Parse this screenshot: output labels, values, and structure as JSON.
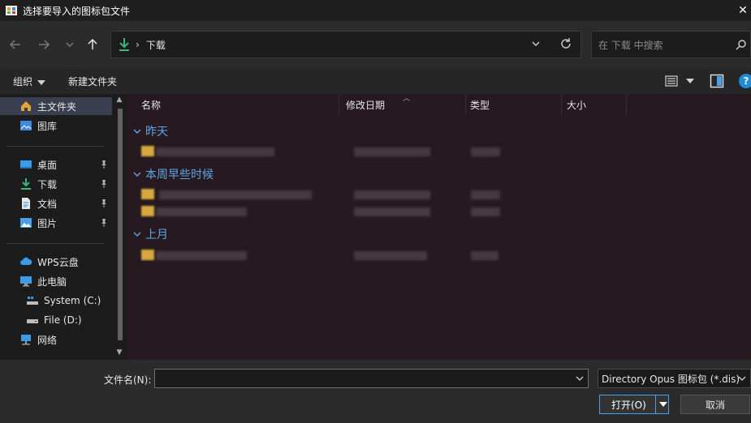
{
  "window": {
    "title": "选择要导入的图标包文件"
  },
  "nav": {
    "address_crumb": "下载",
    "search_placeholder": "在 下载 中搜索"
  },
  "toolbar": {
    "organize_label": "组织",
    "new_folder_label": "新建文件夹"
  },
  "sidebar": {
    "items": [
      {
        "label": "主文件夹",
        "icon": "home-icon",
        "selected": true,
        "pinned": false
      },
      {
        "label": "图库",
        "icon": "gallery-icon",
        "selected": false,
        "pinned": false
      },
      {
        "label": "桌面",
        "icon": "desktop-icon",
        "selected": false,
        "pinned": true
      },
      {
        "label": "下载",
        "icon": "download-icon",
        "selected": false,
        "pinned": true
      },
      {
        "label": "文档",
        "icon": "document-icon",
        "selected": false,
        "pinned": true
      },
      {
        "label": "图片",
        "icon": "pictures-icon",
        "selected": false,
        "pinned": true
      },
      {
        "label": "WPS云盘",
        "icon": "cloud-icon",
        "selected": false,
        "pinned": false
      },
      {
        "label": "此电脑",
        "icon": "computer-icon",
        "selected": false,
        "pinned": false
      },
      {
        "label": "System (C:)",
        "icon": "drive-c-icon",
        "selected": false,
        "pinned": false
      },
      {
        "label": "File (D:)",
        "icon": "drive-d-icon",
        "selected": false,
        "pinned": false
      },
      {
        "label": "网络",
        "icon": "network-icon",
        "selected": false,
        "pinned": false
      }
    ]
  },
  "columns": [
    "名称",
    "修改日期",
    "类型",
    "大小"
  ],
  "groups": [
    {
      "label": "昨天"
    },
    {
      "label": "本周早些时候"
    },
    {
      "label": "上月"
    }
  ],
  "bottom": {
    "filename_label": "文件名(N):",
    "filename_value": "",
    "filter_value": "Directory Opus 图标包 (*.dis)",
    "open_label": "打开(O)",
    "cancel_label": "取消"
  },
  "colors": {
    "accent": "#4aa0e8",
    "group_header": "#5ea6e6",
    "folder": "#d6a83e"
  }
}
